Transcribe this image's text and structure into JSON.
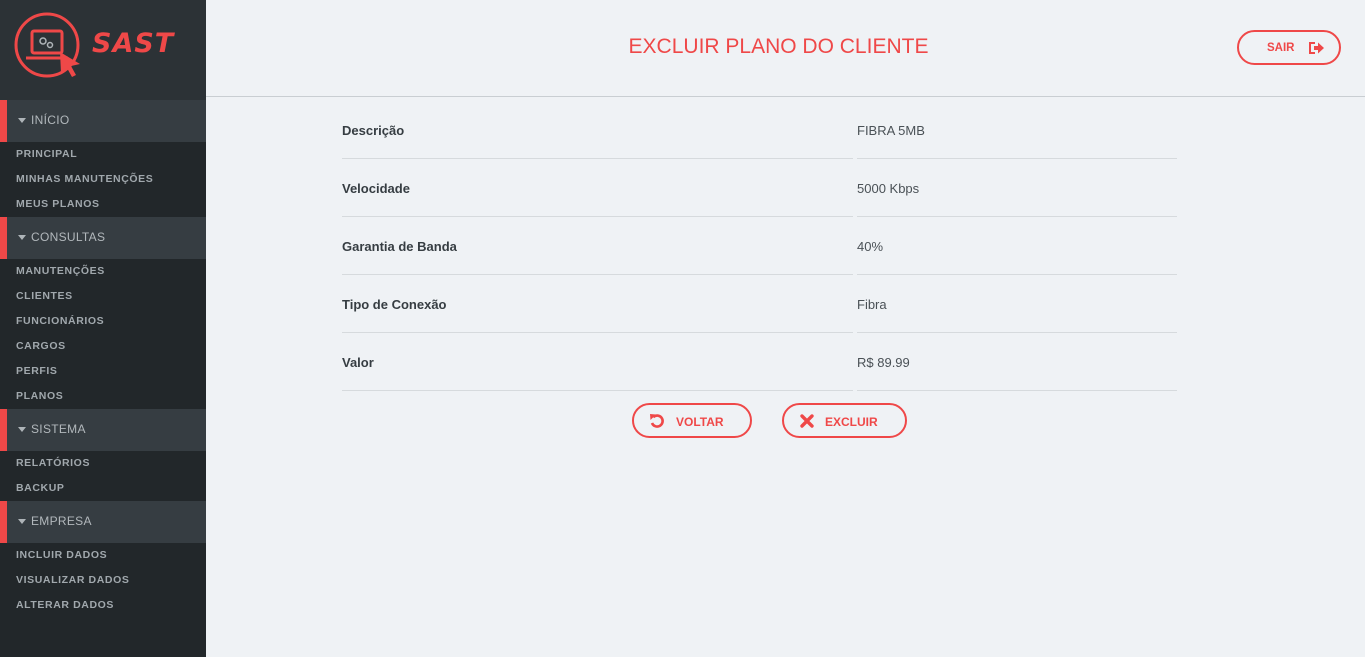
{
  "brand": {
    "name": "SAST",
    "color": "#ef4848"
  },
  "sidebar": {
    "sections": [
      {
        "label": "INÍCIO",
        "items": [
          "PRINCIPAL",
          "MINHAS MANUTENÇÕES",
          "MEUS PLANOS"
        ]
      },
      {
        "label": "CONSULTAS",
        "items": [
          "MANUTENÇÕES",
          "CLIENTES",
          "FUNCIONÁRIOS",
          "CARGOS",
          "PERFIS",
          "PLANOS"
        ]
      },
      {
        "label": "SISTEMA",
        "items": [
          "RELATÓRIOS",
          "BACKUP"
        ]
      },
      {
        "label": "EMPRESA",
        "items": [
          "INCLUIR DADOS",
          "VISUALIZAR DADOS",
          "ALTERAR DADOS"
        ]
      }
    ]
  },
  "header": {
    "title": "EXCLUIR PLANO DO CLIENTE",
    "logout_label": "SAIR",
    "logout_icon": "sign-out-icon"
  },
  "details": [
    {
      "label": "Descrição",
      "value": "FIBRA 5MB"
    },
    {
      "label": "Velocidade",
      "value": "5000 Kbps"
    },
    {
      "label": "Garantia de Banda",
      "value": "40%"
    },
    {
      "label": "Tipo de Conexão",
      "value": "Fibra"
    },
    {
      "label": "Valor",
      "value": "R$ 89.99"
    }
  ],
  "actions": {
    "back_label": "VOLTAR",
    "back_icon": "undo-icon",
    "delete_label": "EXCLUIR",
    "delete_icon": "close-icon"
  }
}
